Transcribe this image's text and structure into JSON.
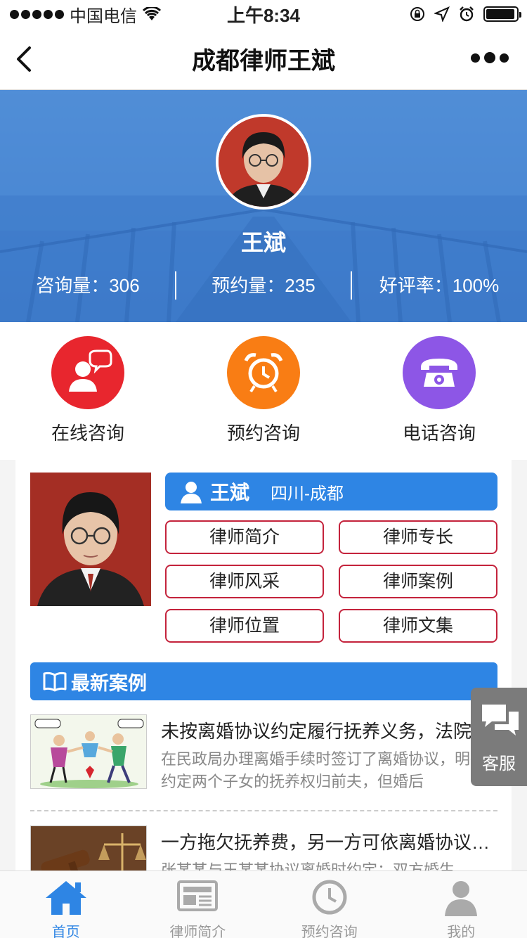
{
  "status_bar": {
    "carrier": "中国电信",
    "time": "上午8:34"
  },
  "navbar": {
    "title": "成都律师王斌"
  },
  "profile": {
    "name": "王斌",
    "stats": [
      {
        "label": "咨询量：306"
      },
      {
        "label": "预约量：235"
      },
      {
        "label": "好评率：100%"
      }
    ]
  },
  "quick_actions": [
    {
      "label": "在线咨询",
      "icon": "chat-person-icon",
      "color": "#e8262e"
    },
    {
      "label": "预约咨询",
      "icon": "alarm-clock-icon",
      "color": "#f97d14"
    },
    {
      "label": "电话咨询",
      "icon": "telephone-icon",
      "color": "#8d56e6"
    }
  ],
  "lawyer_card": {
    "name": "王斌",
    "location": "四川-成都",
    "buttons": [
      "律师简介",
      "律师专长",
      "律师风采",
      "律师案例",
      "律师位置",
      "律师文集"
    ]
  },
  "latest_cases": {
    "title": "最新案例",
    "items": [
      {
        "title": "未按离婚协议约定履行抚养义务，法院判决变更抚养权",
        "summary": "在民政局办理离婚手续时签订了离婚协议，明确约定两个子女的抚养权归前夫，但婚后"
      },
      {
        "title": "一方拖欠抚养费，另一方可依离婚协议起诉",
        "summary": "张某某与王某某协议离婚时约定：双方婚生"
      }
    ]
  },
  "service": {
    "label": "客服"
  },
  "tabbar": [
    {
      "label": "首页",
      "icon": "home-icon",
      "active": true
    },
    {
      "label": "律师简介",
      "icon": "newspaper-icon",
      "active": false
    },
    {
      "label": "预约咨询",
      "icon": "clock-icon",
      "active": false
    },
    {
      "label": "我的",
      "icon": "person-icon",
      "active": false
    }
  ],
  "colors": {
    "accent": "#2e85e4",
    "button_border": "#c4233c"
  }
}
